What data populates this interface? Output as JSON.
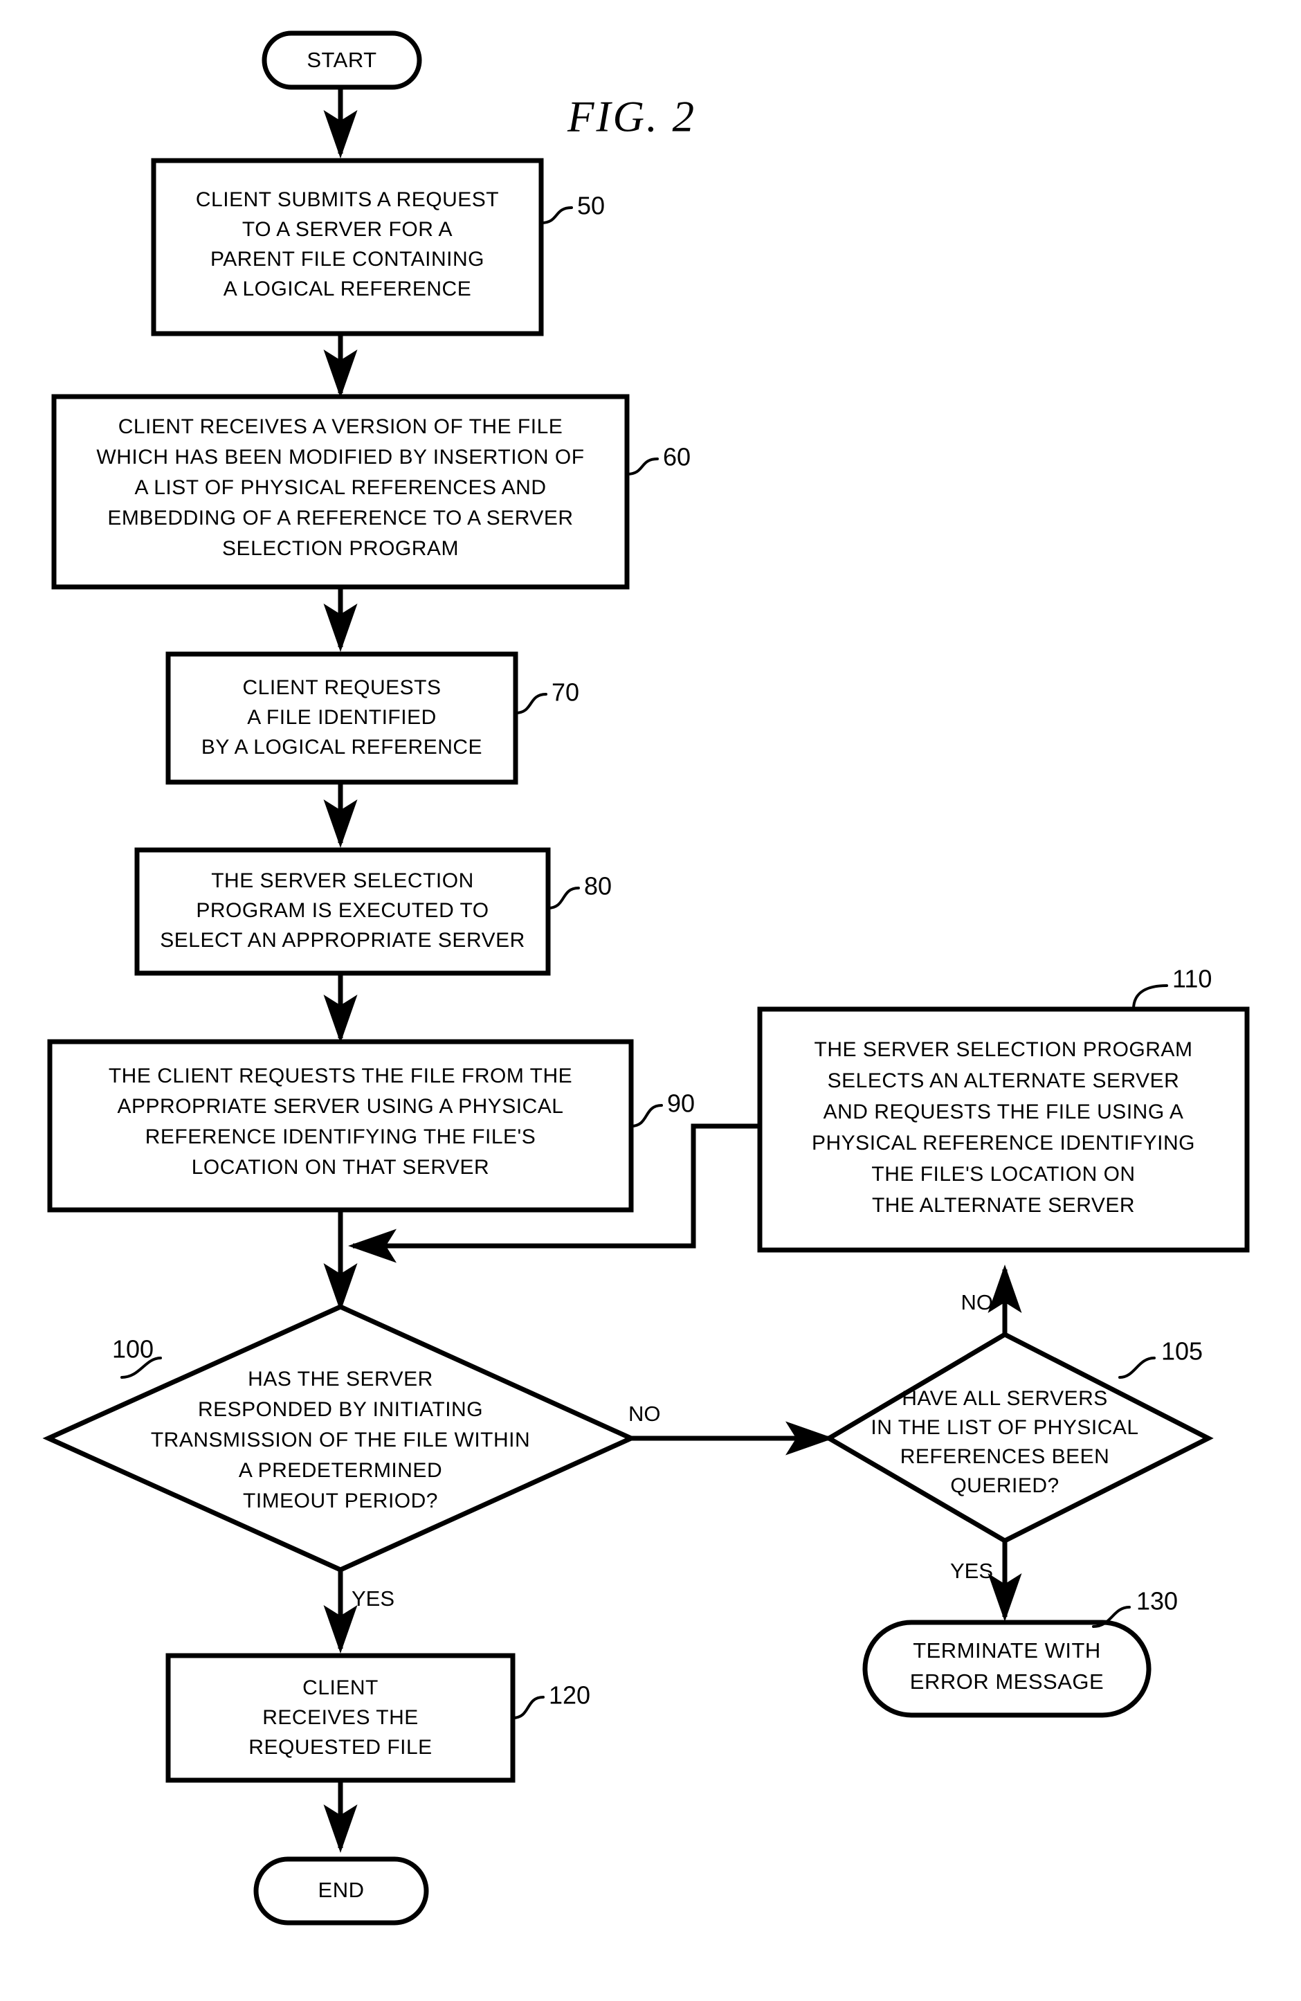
{
  "figure": {
    "title": "FIG.  2"
  },
  "nodes": {
    "start": {
      "label": "START",
      "shape": "terminal"
    },
    "n50": {
      "ref": "50",
      "shape": "process",
      "lines": [
        "CLIENT SUBMITS A REQUEST",
        "TO A SERVER FOR A",
        "PARENT FILE CONTAINING",
        "A LOGICAL REFERENCE"
      ]
    },
    "n60": {
      "ref": "60",
      "shape": "process",
      "lines": [
        "CLIENT RECEIVES A VERSION OF THE FILE",
        "WHICH HAS BEEN MODIFIED BY INSERTION OF",
        "A LIST OF PHYSICAL REFERENCES AND",
        "EMBEDDING OF A REFERENCE TO A SERVER",
        "SELECTION PROGRAM"
      ]
    },
    "n70": {
      "ref": "70",
      "shape": "process",
      "lines": [
        "CLIENT REQUESTS",
        "A FILE IDENTIFIED",
        "BY A LOGICAL REFERENCE"
      ]
    },
    "n80": {
      "ref": "80",
      "shape": "process",
      "lines": [
        "THE SERVER SELECTION",
        "PROGRAM IS EXECUTED TO",
        "SELECT AN APPROPRIATE SERVER"
      ]
    },
    "n90": {
      "ref": "90",
      "shape": "process",
      "lines": [
        "THE CLIENT REQUESTS THE FILE FROM THE",
        "APPROPRIATE SERVER USING A PHYSICAL",
        "REFERENCE IDENTIFYING THE FILE'S",
        "LOCATION ON THAT SERVER"
      ]
    },
    "n110": {
      "ref": "110",
      "shape": "process",
      "lines": [
        "THE SERVER SELECTION PROGRAM",
        "SELECTS AN ALTERNATE SERVER",
        "AND REQUESTS THE FILE USING A",
        "PHYSICAL REFERENCE IDENTIFYING",
        "THE FILE'S LOCATION ON",
        "THE ALTERNATE SERVER"
      ]
    },
    "n100": {
      "ref": "100",
      "shape": "decision",
      "lines": [
        "HAS THE SERVER",
        "RESPONDED BY INITIATING",
        "TRANSMISSION OF THE FILE WITHIN",
        "A PREDETERMINED",
        "TIMEOUT PERIOD?"
      ]
    },
    "n105": {
      "ref": "105",
      "shape": "decision",
      "lines": [
        "HAVE ALL SERVERS",
        "IN THE LIST OF PHYSICAL",
        "REFERENCES BEEN",
        "QUERIED?"
      ]
    },
    "n120": {
      "ref": "120",
      "shape": "process",
      "lines": [
        "CLIENT",
        "RECEIVES THE",
        "REQUESTED FILE"
      ]
    },
    "n130": {
      "ref": "130",
      "shape": "terminal",
      "lines": [
        "TERMINATE WITH",
        "ERROR MESSAGE"
      ]
    },
    "end": {
      "label": "END",
      "shape": "terminal"
    }
  },
  "branch_labels": {
    "d100_no": "NO",
    "d100_yes": "YES",
    "d105_no": "NO",
    "d105_yes": "YES"
  },
  "colors": {
    "ink": "#000000",
    "paper": "#ffffff"
  }
}
